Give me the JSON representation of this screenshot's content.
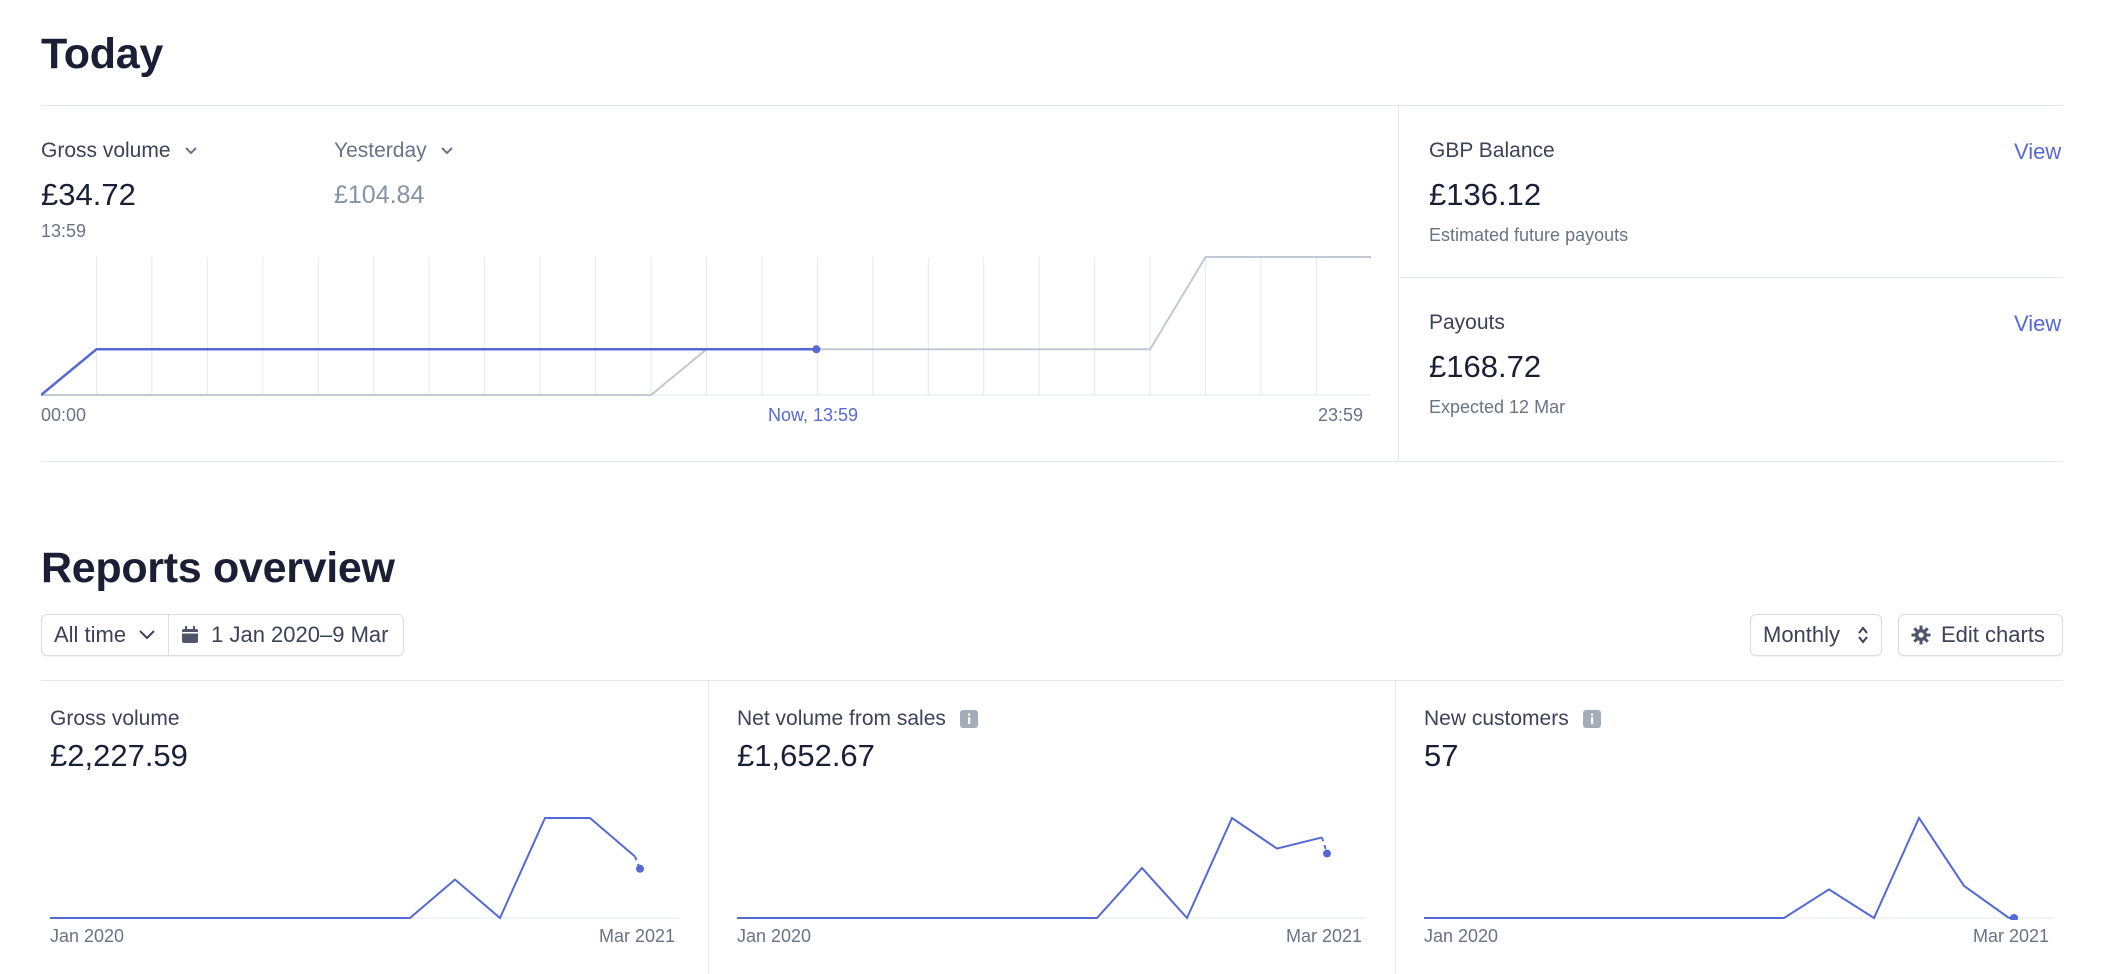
{
  "today": {
    "title": "Today",
    "gross_label": "Gross volume",
    "gross_value": "£34.72",
    "gross_time": "13:59",
    "yesterday_label": "Yesterday",
    "yesterday_value": "£104.84",
    "axis_start": "00:00",
    "axis_now": "Now, 13:59",
    "axis_end": "23:59",
    "chart_color": "#5469d4"
  },
  "balance": {
    "label": "GBP Balance",
    "view_label": "View",
    "value": "£136.12",
    "caption": "Estimated future payouts"
  },
  "payouts": {
    "label": "Payouts",
    "view_label": "View",
    "value": "£168.72",
    "caption": "Expected 12 Mar"
  },
  "reports": {
    "title": "Reports overview",
    "range_label": "All time",
    "date_range": "1 Jan 2020–9 Mar",
    "interval_label": "Monthly",
    "edit_label": "Edit charts",
    "cards": [
      {
        "label": "Gross volume",
        "value": "£2,227.59",
        "x_start": "Jan 2020",
        "x_end": "Mar 2021"
      },
      {
        "label": "Net volume from sales",
        "value": "£1,652.67",
        "x_start": "Jan 2020",
        "x_end": "Mar 2021"
      },
      {
        "label": "New customers",
        "value": "57",
        "x_start": "Jan 2020",
        "x_end": "Mar 2021"
      }
    ]
  },
  "chart_data": [
    {
      "type": "line",
      "x": [
        "00:00",
        "01:00",
        "02:00",
        "03:00",
        "04:00",
        "05:00",
        "06:00",
        "07:00",
        "08:00",
        "09:00",
        "10:00",
        "11:00",
        "12:00",
        "13:00",
        "13:59"
      ],
      "series": [
        {
          "name": "Gross volume",
          "values": [
            0,
            34.72,
            34.72,
            34.72,
            34.72,
            34.72,
            34.72,
            34.72,
            34.72,
            34.72,
            34.72,
            34.72,
            34.72,
            34.72,
            34.72
          ]
        }
      ],
      "comparison": {
        "name": "Yesterday",
        "x": [
          "00:00",
          "11:00",
          "12:00",
          "20:00",
          "21:00",
          "23:59"
        ],
        "values": [
          0,
          0,
          34.72,
          34.72,
          104.84,
          104.84
        ]
      },
      "xlim": [
        "00:00",
        "23:59"
      ]
    },
    {
      "type": "line",
      "x": [
        "Jan 2020",
        "Feb 2020",
        "Mar 2020",
        "Apr 2020",
        "May 2020",
        "Jun 2020",
        "Jul 2020",
        "Aug 2020",
        "Sep 2020",
        "Oct 2020",
        "Nov 2020",
        "Dec 2020",
        "Jan 2021",
        "Feb 2021",
        "Mar 2021"
      ],
      "series": [
        {
          "name": "Gross volume",
          "values": [
            0,
            0,
            0,
            0,
            0,
            0,
            0,
            0,
            0,
            250,
            0,
            650,
            650,
            400,
            null
          ]
        }
      ],
      "projected_last": 400
    },
    {
      "type": "line",
      "x": [
        "Jan 2020",
        "Feb 2020",
        "Mar 2020",
        "Apr 2020",
        "May 2020",
        "Jun 2020",
        "Jul 2020",
        "Aug 2020",
        "Sep 2020",
        "Oct 2020",
        "Nov 2020",
        "Dec 2020",
        "Jan 2021",
        "Feb 2021",
        "Mar 2021"
      ],
      "series": [
        {
          "name": "Net volume from sales",
          "values": [
            0,
            0,
            0,
            0,
            0,
            0,
            0,
            0,
            0,
            180,
            0,
            360,
            250,
            290,
            null
          ]
        }
      ],
      "projected_last": 290
    },
    {
      "type": "line",
      "x": [
        "Jan 2020",
        "Feb 2020",
        "Mar 2020",
        "Apr 2020",
        "May 2020",
        "Jun 2020",
        "Jul 2020",
        "Aug 2020",
        "Sep 2020",
        "Oct 2020",
        "Nov 2020",
        "Dec 2020",
        "Jan 2021",
        "Feb 2021",
        "Mar 2021"
      ],
      "series": [
        {
          "name": "New customers",
          "values": [
            0,
            0,
            0,
            0,
            0,
            0,
            0,
            0,
            0,
            8,
            0,
            28,
            9,
            0,
            null
          ]
        }
      ],
      "projected_last": 0
    }
  ]
}
